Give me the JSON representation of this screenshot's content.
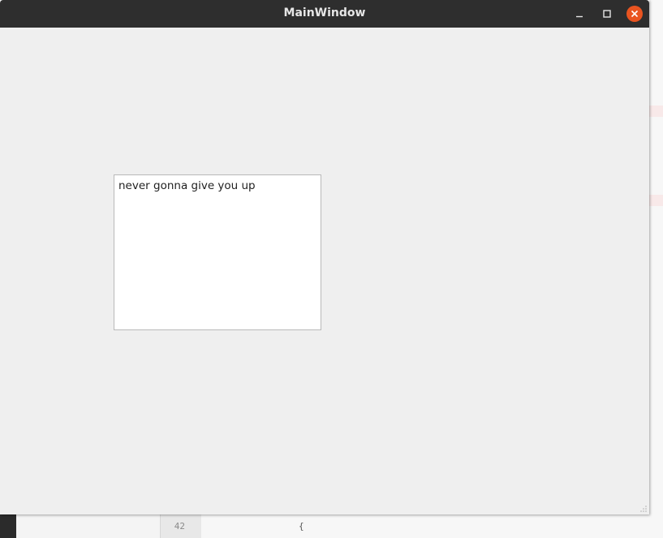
{
  "window": {
    "title": "MainWindow",
    "buttons": {
      "minimize_icon": "minimize-icon",
      "maximize_icon": "maximize-icon",
      "close_icon": "close-icon"
    }
  },
  "text_edit": {
    "value": "never gonna give you up"
  },
  "background_editor": {
    "line_numbers": [
      "42"
    ],
    "code_lines": [
      "{"
    ]
  },
  "colors": {
    "titlebar": "#2e2e2e",
    "close_button": "#e95420",
    "window_background": "#efefef",
    "text_edit_background": "#ffffff"
  }
}
